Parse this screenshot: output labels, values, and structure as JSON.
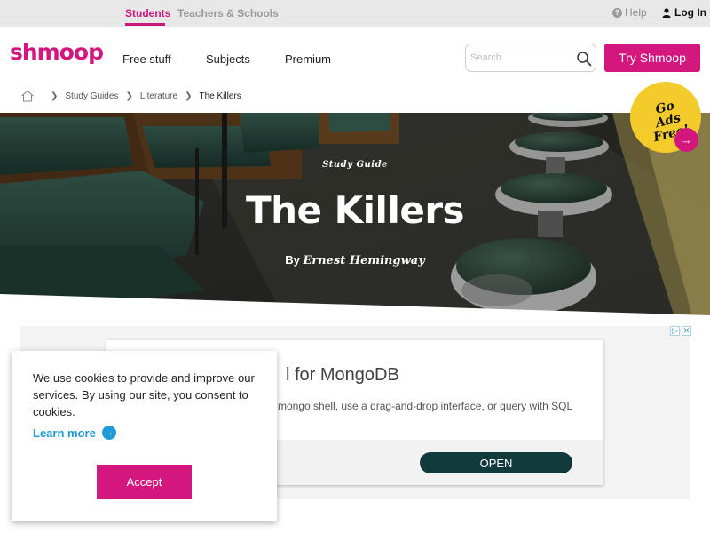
{
  "topbar": {
    "audience_students": "Students",
    "audience_teachers": "Teachers & Schools",
    "help": "Help",
    "login": "Log In"
  },
  "header": {
    "logo": "shmoop",
    "nav": [
      "Free stuff",
      "Subjects",
      "Premium"
    ],
    "search_placeholder": "Search",
    "cta": "Try Shmoop",
    "brand_color": "#d4177f"
  },
  "breadcrumb": {
    "items": [
      "Study Guides",
      "Literature"
    ],
    "current": "The Killers"
  },
  "hero": {
    "overline": "Study Guide",
    "title": "The Killers",
    "by": "By",
    "author": "Ernest Hemingway"
  },
  "badge": {
    "line1": "Go",
    "line2": "Ads Free!",
    "color": "#f3cc2b"
  },
  "ad": {
    "title": "l for MongoDB",
    "description": "mongo shell, use a drag-and-drop interface, or query with SQL",
    "button": "OPEN"
  },
  "cookie": {
    "text": "We use cookies to provide and improve our services. By using our site, you consent to cookies.",
    "learn_more": "Learn more",
    "accept": "Accept"
  }
}
